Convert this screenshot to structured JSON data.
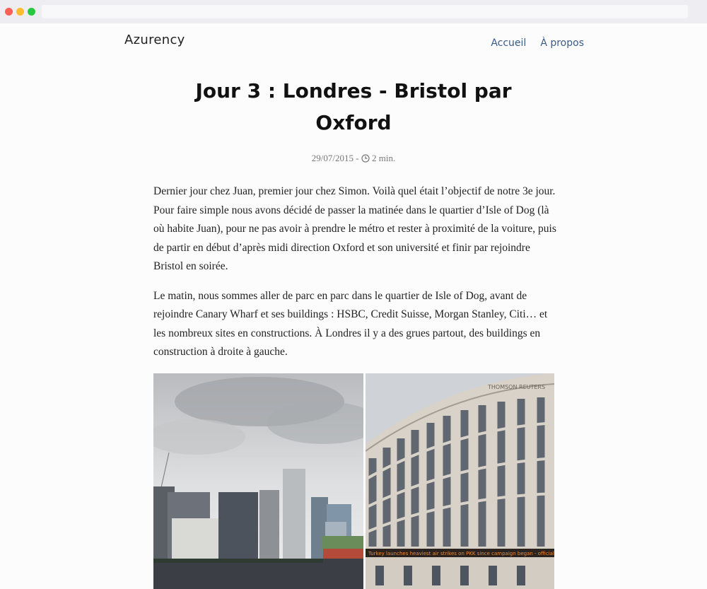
{
  "site": {
    "logo": "Azurency",
    "nav": [
      {
        "label": "Accueil"
      },
      {
        "label": "À propos"
      }
    ]
  },
  "post": {
    "title_line1": "Jour 3 : Londres - Bristol par",
    "title_line2": "Oxford",
    "date": "29/07/2015",
    "separator": "-",
    "reading_time": "2 min.",
    "paragraphs": [
      "Dernier jour chez Juan, premier jour chez Simon. Voilà quel était l’objectif de notre 3e jour. Pour faire simple nous avons décidé de passer la matinée dans le quartier d’Isle of Dog (là où habite Juan), pour ne pas avoir à prendre le métro et rester à proximité de la voiture, puis de partir en début d’après midi direction Oxford et son université et finir par rejoindre Bristol en soirée.",
      "Le matin, nous sommes aller de parc en parc dans le quartier de Isle of Dog, avant de rejoindre Canary Wharf et ses buildings : HSBC, Credit Suisse, Morgan Stanley, Citi… et les nombreux sites en constructions. À Londres il y a des grues partout, des buildings en construction à droite à gauche."
    ]
  },
  "photos": {
    "right_sign": "THOMSON REUTERS",
    "right_ticker": "Turkey launches heaviest air strikes on PKK since campaign began - official"
  },
  "colors": {
    "accent": "#3b5a86",
    "sky": "#d9dadc",
    "water": "#3b3f45"
  }
}
